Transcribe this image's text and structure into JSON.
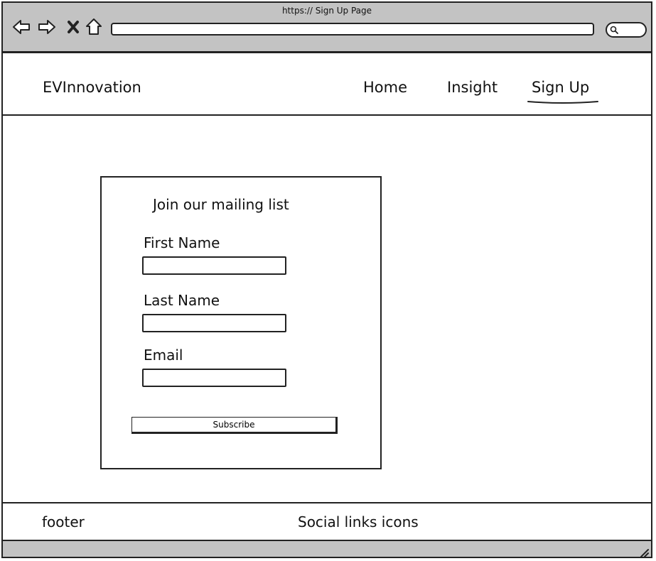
{
  "browser": {
    "title": "https:// Sign Up Page",
    "icons": {
      "back": "arrow-left-icon",
      "forward": "arrow-right-icon",
      "close": "close-icon",
      "home": "home-icon",
      "search": "search-icon"
    }
  },
  "header": {
    "brand": "EVInnovation",
    "nav": [
      {
        "label": "Home",
        "active": false
      },
      {
        "label": "Insight",
        "active": false
      },
      {
        "label": "Sign Up",
        "active": true
      }
    ]
  },
  "form": {
    "title": "Join our mailing list",
    "fields": [
      {
        "label": "First Name",
        "value": ""
      },
      {
        "label": "Last Name",
        "value": ""
      },
      {
        "label": "Email",
        "value": ""
      }
    ],
    "submit_label": "Subscribe"
  },
  "footer": {
    "left": "footer",
    "social": "Social links icons"
  },
  "colors": {
    "chrome": "#c3c3c3",
    "border": "#222222"
  }
}
